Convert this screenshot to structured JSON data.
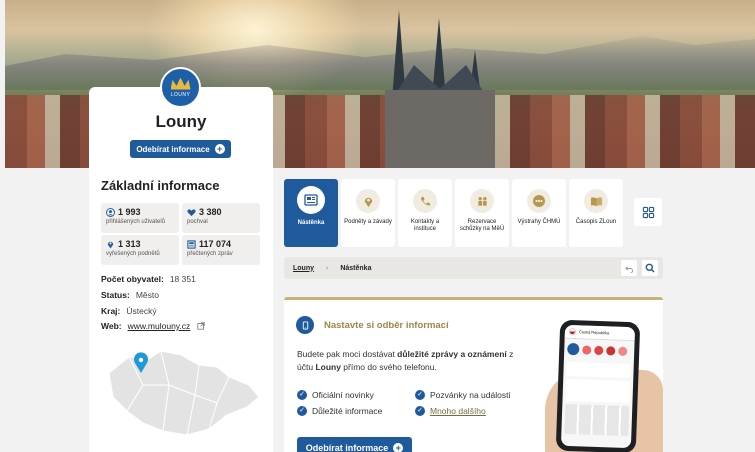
{
  "city": {
    "name": "Louny",
    "logo_text": "LOUNY"
  },
  "subscribe_button": "Odebírat informace",
  "basic": {
    "title": "Základní informace",
    "stats": [
      {
        "value": "1 993",
        "label": "přihlášených uživatelů",
        "icon": "user-icon"
      },
      {
        "value": "3 380",
        "label": "pochval",
        "icon": "heart-icon"
      },
      {
        "value": "1 313",
        "label": "vyřešených podnětů",
        "icon": "pin-icon"
      },
      {
        "value": "117 074",
        "label": "přečtených zpráv",
        "icon": "news-icon"
      }
    ],
    "population_label": "Počet obyvatel:",
    "population": "18 351",
    "status_label": "Status:",
    "status": "Město",
    "region_label": "Kraj:",
    "region": "Ústecký",
    "web_label": "Web:",
    "web": "www.mulouny.cz"
  },
  "tiles": [
    {
      "label": "Nástěnka",
      "icon": "board-icon"
    },
    {
      "label": "Podněty a závady",
      "icon": "pin-icon"
    },
    {
      "label": "Kontakty a instituce",
      "icon": "contact-icon"
    },
    {
      "label": "Rezervace schůzky na MěÚ",
      "icon": "people-icon"
    },
    {
      "label": "Výstrahy ČHMÚ",
      "icon": "warning-icon"
    },
    {
      "label": "Časopis ZLoun",
      "icon": "book-icon"
    }
  ],
  "breadcrumb": {
    "first": "Louny",
    "second": "Nástěnka"
  },
  "promo": {
    "title": "Nastavte si odběr informací",
    "desc_1": "Budete pak moci dostávat ",
    "desc_bold_1": "důležité zprávy a oznámení",
    "desc_2": " z účtu ",
    "desc_bold_2": "Louny",
    "desc_3": " přímo do svého telefonu.",
    "items": [
      "Oficiální novinky",
      "Pozvánky na události",
      "Důležité informace",
      "Mnoho dalšího"
    ],
    "phone_header": "Česká Republika"
  },
  "colors": {
    "primary": "#1f5b9c",
    "gold": "#c9b27a",
    "bg": "#f2f2f2"
  }
}
